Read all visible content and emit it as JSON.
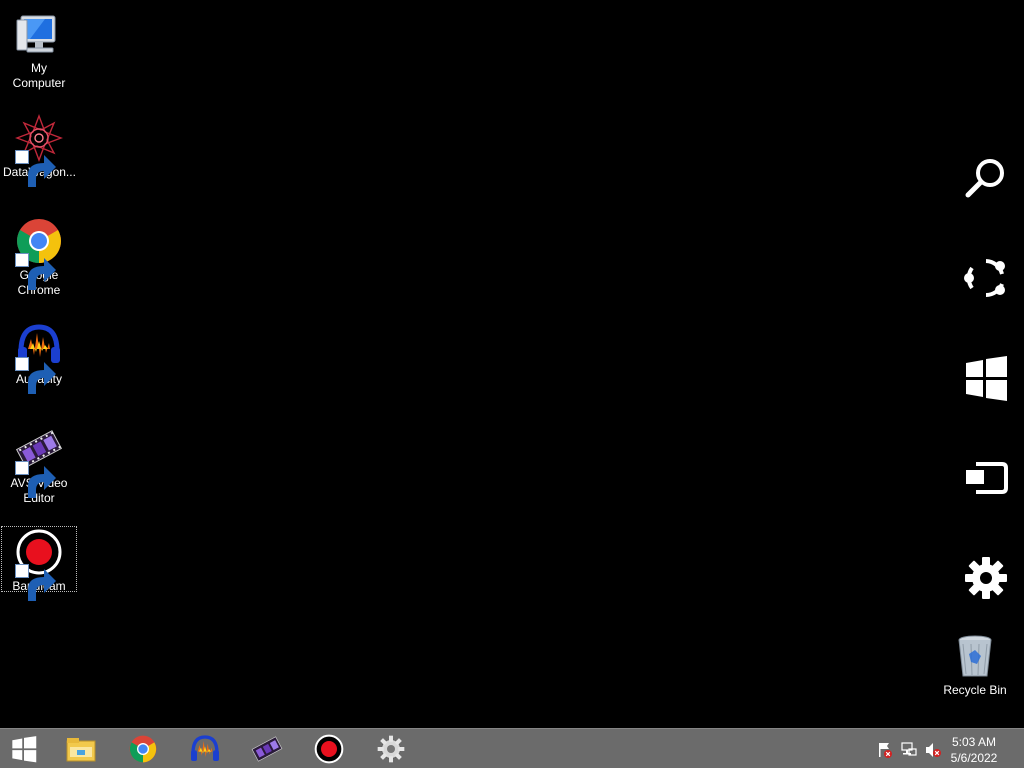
{
  "desktop": {
    "icons": [
      {
        "label": "My Computer",
        "icon": "my-computer-icon"
      },
      {
        "label": "DataWagon...",
        "icon": "datawagon-icon"
      },
      {
        "label": "Google Chrome",
        "icon": "chrome-icon"
      },
      {
        "label": "Audacity",
        "icon": "audacity-icon"
      },
      {
        "label": "AVS Video Editor",
        "icon": "avs-video-editor-icon"
      },
      {
        "label": "Bandicam",
        "icon": "bandicam-icon"
      },
      {
        "label": "Recycle Bin",
        "icon": "recycle-bin-icon"
      }
    ]
  },
  "charms": [
    "search-icon",
    "share-icon",
    "start-icon",
    "devices-icon",
    "settings-icon"
  ],
  "taskbar": {
    "pinned": [
      "start-button",
      "file-explorer-icon",
      "chrome-icon",
      "audacity-icon",
      "avs-video-editor-icon",
      "bandicam-icon",
      "settings-gear-icon"
    ],
    "clock": {
      "time": "5:03 AM",
      "date": "5/6/2022"
    }
  },
  "colors": {
    "taskbar": "#6b6b6b",
    "desktop": "#000000",
    "bandicam_red": "#e8101e"
  }
}
